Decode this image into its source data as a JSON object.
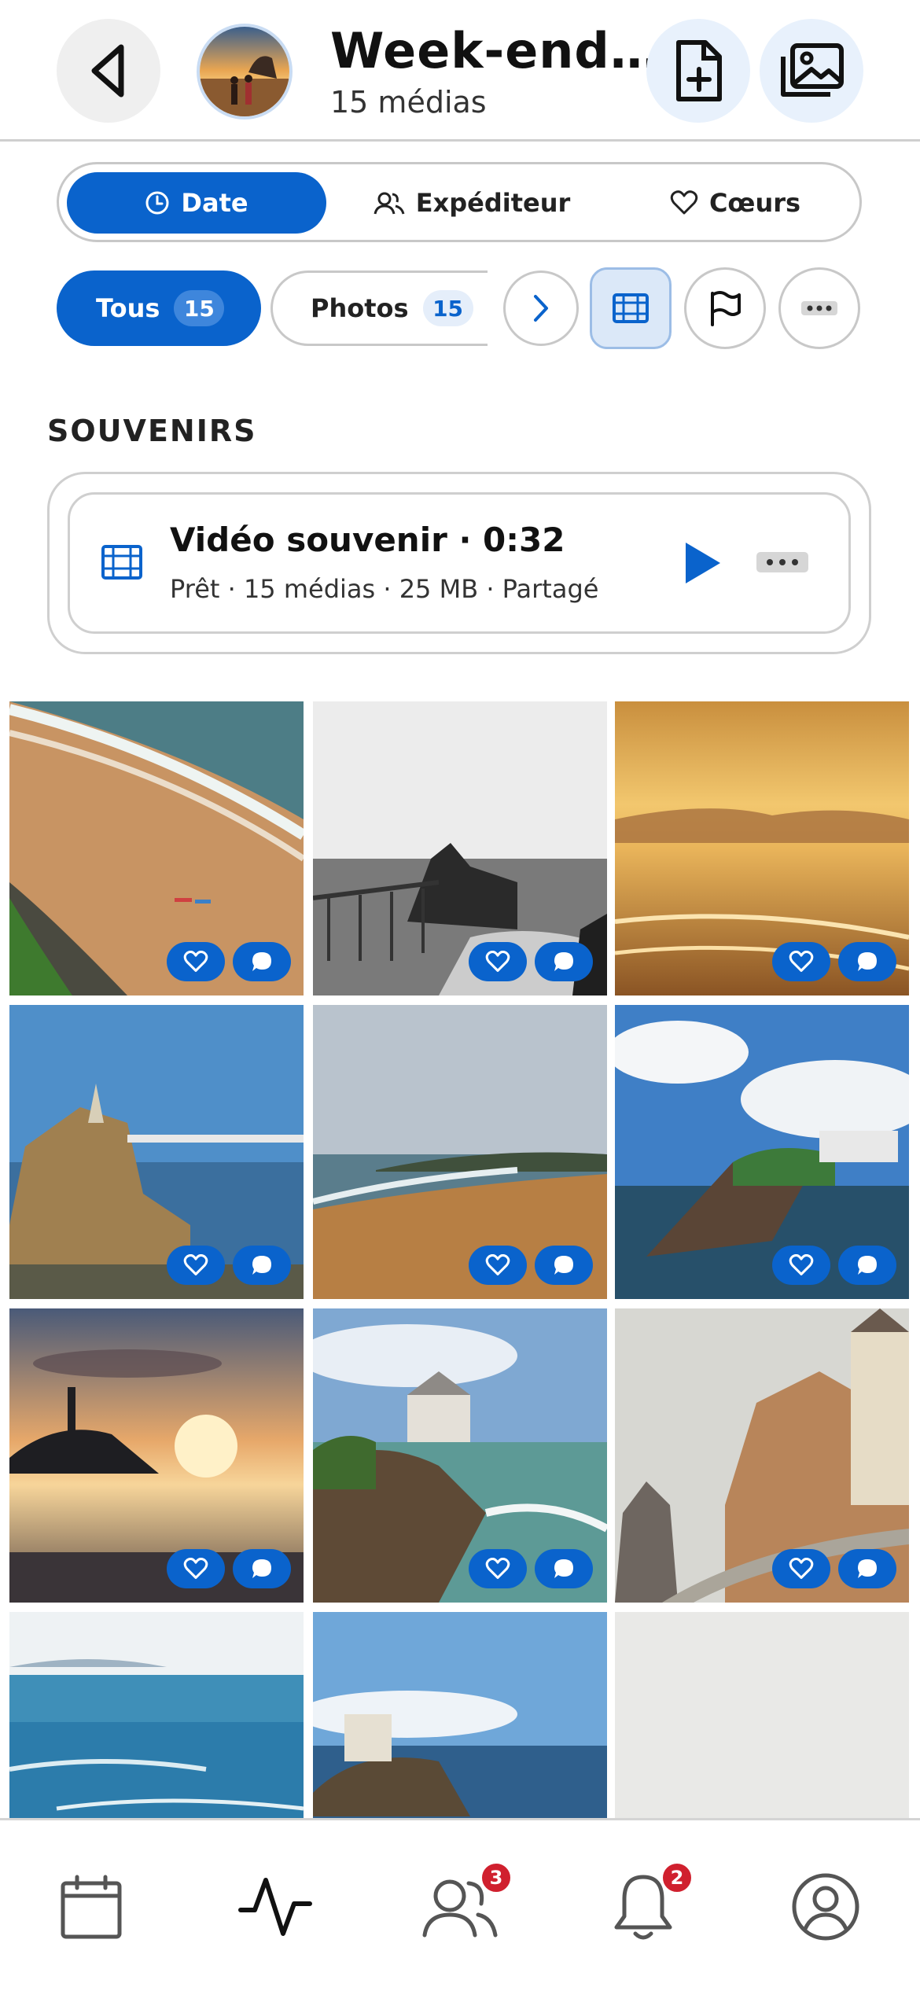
{
  "header": {
    "title": "Week-end…",
    "subtitle": "15 médias",
    "icons": {
      "back": "back-triangle-icon",
      "add_doc": "file-plus-icon",
      "gallery": "images-icon"
    }
  },
  "segment": {
    "items": [
      {
        "label": "Date",
        "icon": "clock-icon",
        "active": true
      },
      {
        "label": "Expéditeur",
        "icon": "users-icon",
        "active": false
      },
      {
        "label": "Cœurs",
        "icon": "heart-icon",
        "active": false
      }
    ]
  },
  "filters": {
    "all": {
      "label": "Tous",
      "count": "15"
    },
    "photos": {
      "label": "Photos",
      "count": "15"
    }
  },
  "souvenirs": {
    "section_title": "SOUVENIRS",
    "card": {
      "title": "Vidéo souvenir · 0:32",
      "subtitle": "Prêt · 15 médias · 25 MB · Partagé"
    }
  },
  "tabbar": {
    "items": [
      {
        "name": "calendar",
        "badge": ""
      },
      {
        "name": "activity",
        "badge": ""
      },
      {
        "name": "contacts",
        "badge": "3"
      },
      {
        "name": "notifications",
        "badge": "2"
      },
      {
        "name": "profile",
        "badge": ""
      }
    ]
  },
  "colors": {
    "accent": "#0a63cc",
    "badge_red": "#d0202e",
    "border": "#c8c8c8"
  }
}
